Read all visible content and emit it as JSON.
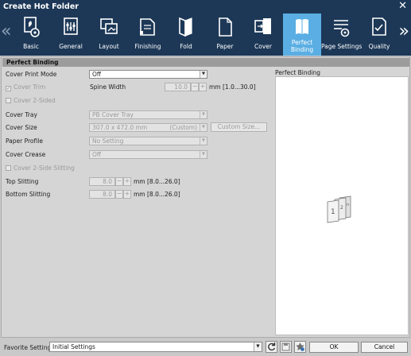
{
  "window": {
    "title": "Create Hot Folder"
  },
  "tabs": [
    {
      "label": "Basic",
      "icon": "basic-icon"
    },
    {
      "label": "General",
      "icon": "general-icon"
    },
    {
      "label": "Layout",
      "icon": "layout-icon"
    },
    {
      "label": "Finishing",
      "icon": "finishing-icon"
    },
    {
      "label": "Fold",
      "icon": "fold-icon"
    },
    {
      "label": "Paper",
      "icon": "paper-icon"
    },
    {
      "label": "Cover",
      "icon": "cover-icon"
    },
    {
      "label": "Perfect\nBinding",
      "icon": "perfect-binding-icon",
      "active": true
    },
    {
      "label": "Page Settings",
      "icon": "page-settings-icon"
    },
    {
      "label": "Quality",
      "icon": "quality-icon"
    }
  ],
  "section": {
    "title": "Perfect Binding"
  },
  "form": {
    "cover_print_mode": {
      "label": "Cover Print Mode",
      "value": "Off"
    },
    "cover_trim": {
      "label": "Cover Trim",
      "checked": true
    },
    "spine_width": {
      "label": "Spine Width",
      "value": "10.0",
      "unit": "mm [1.0...30.0]"
    },
    "cover_2_sided": {
      "label": "Cover 2-Sided",
      "checked": false
    },
    "cover_tray": {
      "label": "Cover Tray",
      "value": "PB Cover Tray"
    },
    "cover_size": {
      "label": "Cover Size",
      "value": "307.0 x 472.0 mm",
      "tag": "(Custom)",
      "button": "Custom Size..."
    },
    "paper_profile": {
      "label": "Paper Profile",
      "value": "No Setting"
    },
    "cover_crease": {
      "label": "Cover Crease",
      "value": "Off"
    },
    "cover_2_side_slitting": {
      "label": "Cover 2-Side Slitting",
      "checked": false
    },
    "top_slitting": {
      "label": "Top Slitting",
      "value": "8.0",
      "unit": "mm [8.0...26.0]"
    },
    "bottom_slitting": {
      "label": "Bottom Slitting",
      "value": "8.0",
      "unit": "mm [8.0...26.0]"
    },
    "spin_minus": "−",
    "spin_plus": "+"
  },
  "preview": {
    "title": "Perfect Binding",
    "page_labels": [
      "1",
      "2",
      "n"
    ]
  },
  "footer": {
    "favorite_label": "Favorite Setting",
    "favorite_value": "Initial Settings",
    "ok_label": "OK",
    "cancel_label": "Cancel"
  },
  "nav": {
    "prev": "«",
    "next": "»",
    "close": "✕",
    "dropdown": "▼"
  },
  "colors": {
    "title_bar": "#1d3857",
    "active_tab": "#5aaee3",
    "panel": "#d5d5d5"
  }
}
